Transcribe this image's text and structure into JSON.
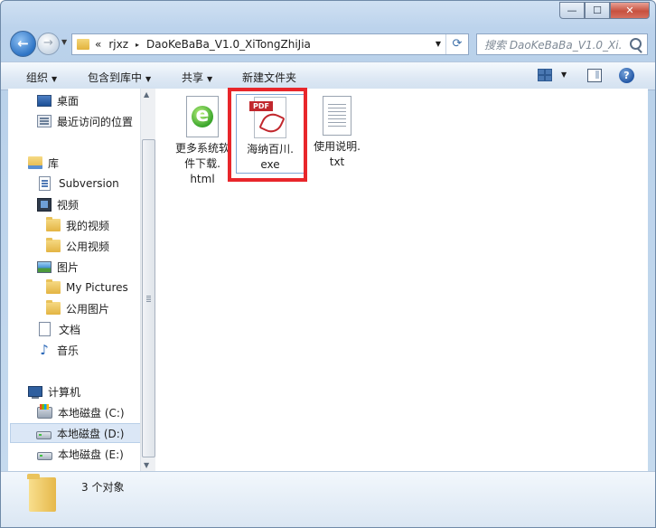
{
  "address": {
    "overflow_glyph": "«",
    "crumbs": [
      "rjxz",
      "DaoKeBaBa_V1.0_XiTongZhiJia"
    ],
    "separator": "▸"
  },
  "search": {
    "placeholder": "搜索 DaoKeBaBa_V1.0_Xi..."
  },
  "toolbar": {
    "organize": "组织",
    "include_library": "包含到库中",
    "share": "共享",
    "new_folder": "新建文件夹",
    "help": "?"
  },
  "caption": {
    "minimize": "—",
    "maximize": "☐",
    "close": "✕"
  },
  "nav": {
    "favorites": [
      {
        "label": "桌面",
        "icon": "desktop-icon"
      },
      {
        "label": "最近访问的位置",
        "icon": "recent-places-icon"
      }
    ],
    "libraries_label": "库",
    "libraries": [
      {
        "label": "Subversion",
        "icon": "subversion-icon"
      },
      {
        "label": "视频",
        "icon": "video-icon"
      },
      {
        "label": "我的视频",
        "icon": "folder-icon"
      },
      {
        "label": "公用视频",
        "icon": "folder-icon"
      },
      {
        "label": "图片",
        "icon": "pictures-icon"
      },
      {
        "label": "My Pictures",
        "icon": "folder-icon"
      },
      {
        "label": "公用图片",
        "icon": "folder-icon"
      },
      {
        "label": "文档",
        "icon": "documents-icon"
      },
      {
        "label": "音乐",
        "icon": "music-icon"
      }
    ],
    "computer_label": "计算机",
    "drives": [
      {
        "label": "本地磁盘 (C:)",
        "icon": "system-drive-icon",
        "selected": false
      },
      {
        "label": "本地磁盘 (D:)",
        "icon": "drive-icon",
        "selected": true
      },
      {
        "label": "本地磁盘 (E:)",
        "icon": "drive-icon",
        "selected": false
      }
    ]
  },
  "files": [
    {
      "name": "更多系统软件下载.html",
      "icon": "html-file-icon"
    },
    {
      "name": "海纳百川.exe",
      "icon": "pdf-exe-icon",
      "selected": true
    },
    {
      "name": "使用说明.txt",
      "icon": "txt-file-icon"
    }
  ],
  "file_name_lines": [
    [
      "更多系统软",
      "件下载.",
      "html"
    ],
    [
      "海纳百川.",
      "exe"
    ],
    [
      "使用说明.",
      "txt"
    ]
  ],
  "status": {
    "item_count": "3 个对象"
  },
  "colors": {
    "highlight_box": "#e8262b",
    "selection": "#dbe7f6"
  }
}
